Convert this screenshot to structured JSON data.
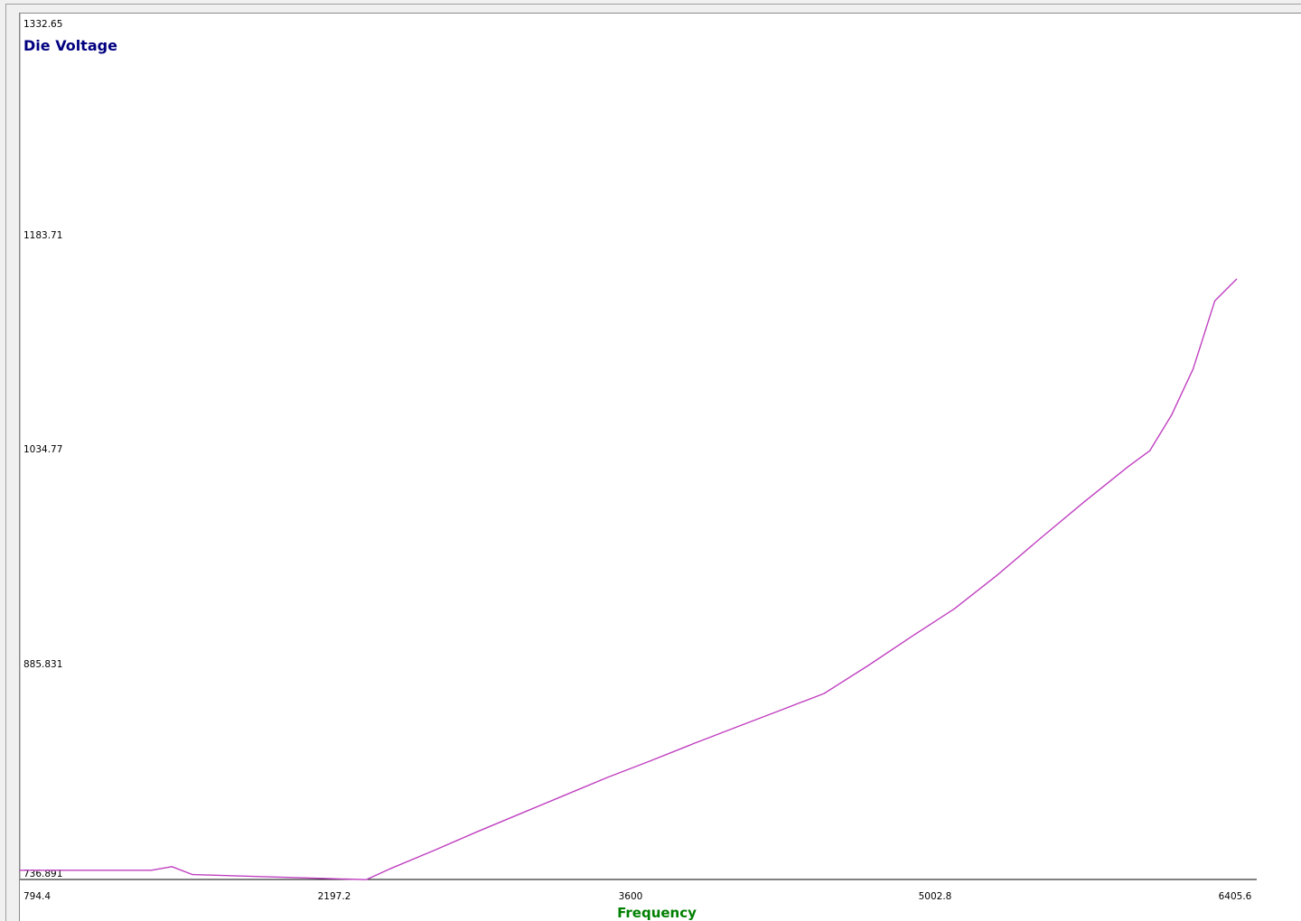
{
  "chart_data": {
    "type": "line",
    "title": "Die Voltage",
    "xlabel": "Frequency",
    "ylabel": "",
    "xlim": [
      794.4,
      6405.6
    ],
    "ylim": [
      736.891,
      1332.65
    ],
    "x_ticks": [
      "794.4",
      "2197.2",
      "3600",
      "5002.8",
      "6405.6"
    ],
    "y_ticks": [
      "1332.65",
      "1183.71",
      "1034.77",
      "885.831",
      "736.891"
    ],
    "grid": false,
    "colors": {
      "line": "#c040c0",
      "title": "#000080",
      "xlabel": "#008000"
    },
    "series": [
      {
        "points": [
          [
            794.4,
            742.0
          ],
          [
            1400,
            742.0
          ],
          [
            1495,
            744.5
          ],
          [
            1590,
            739.0
          ],
          [
            2390,
            735.5
          ],
          [
            2500,
            743.0
          ],
          [
            2700,
            755.5
          ],
          [
            2900,
            768.5
          ],
          [
            3100,
            781.0
          ],
          [
            3300,
            793.5
          ],
          [
            3500,
            806.0
          ],
          [
            3700,
            817.5
          ],
          [
            3900,
            829.5
          ],
          [
            4100,
            841.0
          ],
          [
            4300,
            852.5
          ],
          [
            4500,
            864.0
          ],
          [
            4700,
            883.0
          ],
          [
            4900,
            903.0
          ],
          [
            5100,
            922.5
          ],
          [
            5300,
            946.0
          ],
          [
            5500,
            971.5
          ],
          [
            5700,
            996.5
          ],
          [
            5900,
            1020.5
          ],
          [
            6000,
            1031.5
          ],
          [
            6100,
            1056.0
          ],
          [
            6200,
            1088.0
          ],
          [
            6300,
            1135.0
          ],
          [
            6400,
            1150.0
          ]
        ]
      }
    ]
  }
}
